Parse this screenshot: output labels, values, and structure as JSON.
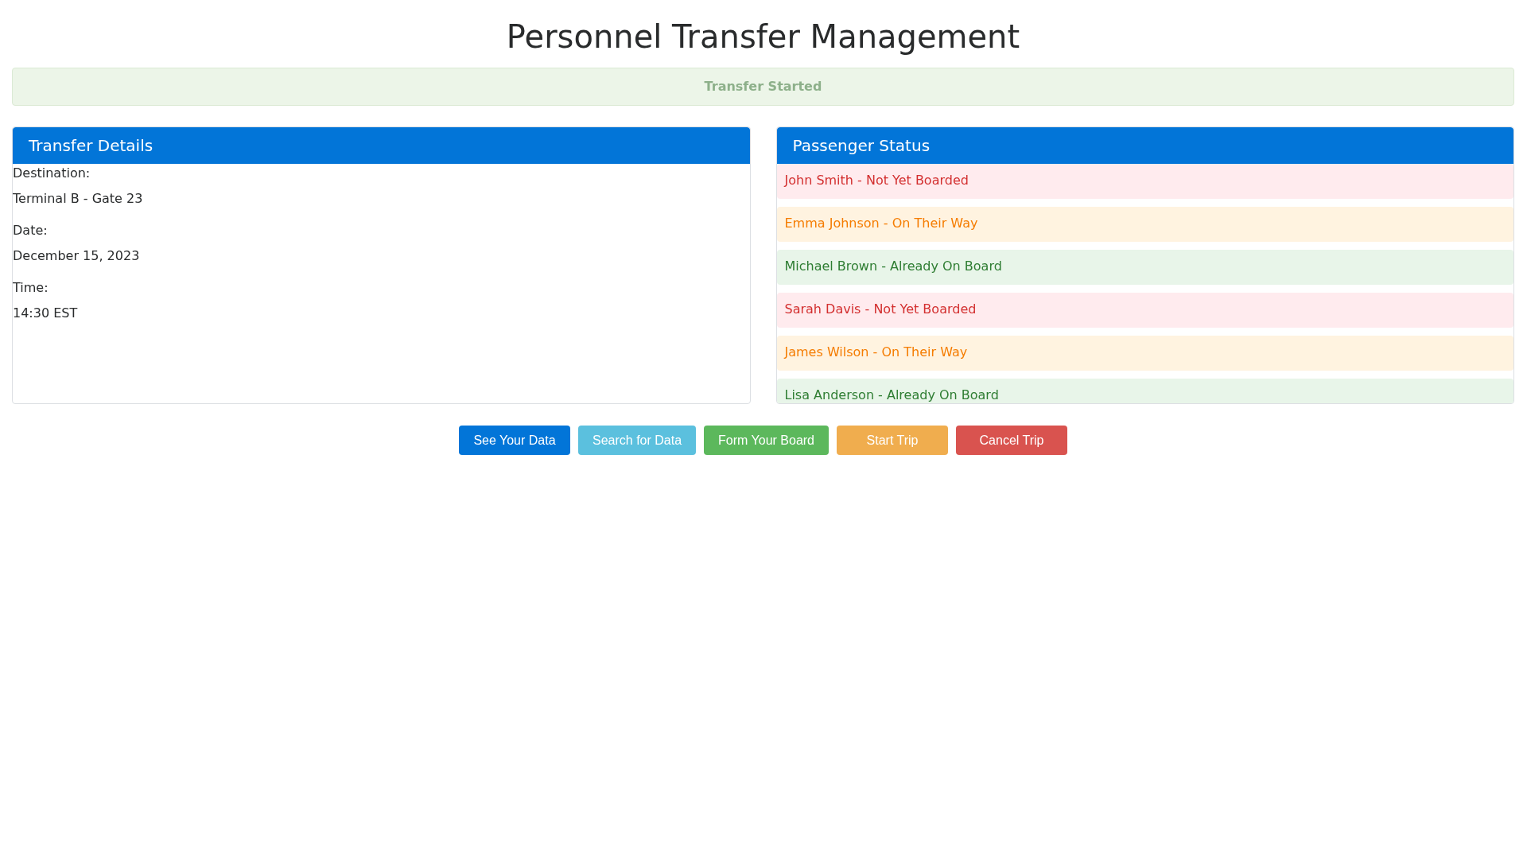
{
  "page_title": "Personnel Transfer Management",
  "status_banner": "Transfer Started",
  "transfer_details": {
    "title": "Transfer Details",
    "fields": [
      {
        "label": "Destination:",
        "value": "Terminal B - Gate 23"
      },
      {
        "label": "Date:",
        "value": "December 15, 2023"
      },
      {
        "label": "Time:",
        "value": "14:30 EST"
      }
    ]
  },
  "passenger_status": {
    "title": "Passenger Status",
    "passengers": [
      {
        "text": "John Smith - Not Yet Boarded",
        "kind": "not_boarded"
      },
      {
        "text": "Emma Johnson - On Their Way",
        "kind": "on_the_way"
      },
      {
        "text": "Michael Brown - Already On Board",
        "kind": "on_board"
      },
      {
        "text": "Sarah Davis - Not Yet Boarded",
        "kind": "not_boarded"
      },
      {
        "text": "James Wilson - On Their Way",
        "kind": "on_the_way"
      },
      {
        "text": "Lisa Anderson - Already On Board",
        "kind": "on_board"
      }
    ]
  },
  "buttons": [
    {
      "label": "See Your Data",
      "kind": "primary"
    },
    {
      "label": "Search for Data",
      "kind": "info"
    },
    {
      "label": "Form Your Board",
      "kind": "success"
    },
    {
      "label": "Start Trip",
      "kind": "warning"
    },
    {
      "label": "Cancel Trip",
      "kind": "danger"
    }
  ]
}
